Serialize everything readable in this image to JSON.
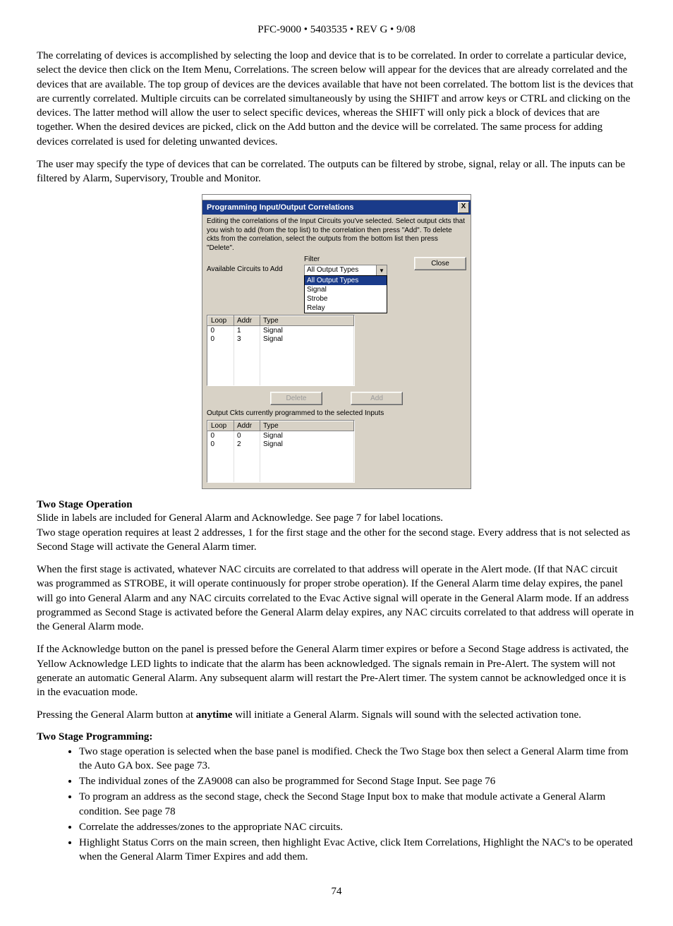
{
  "header": "PFC-9000 • 5403535 • REV G • 9/08",
  "para1": "The correlating of devices is accomplished by selecting the loop and device that is to be correlated. In order to correlate a particular device, select the device then click on the Item Menu, Correlations. The screen below will appear for the devices that are already correlated and the devices that are available. The top group of devices are the devices available that have not been correlated. The bottom list is the devices that are currently correlated. Multiple circuits can be correlated simultaneously by using the SHIFT and arrow keys or CTRL and clicking on the devices. The latter method will allow the user to select specific devices, whereas the SHIFT will only pick a block of devices that are together. When the desired devices are picked, click on the Add button and the device will be correlated. The same process for adding devices correlated is used for deleting unwanted devices.",
  "para2": "The user may specify the type of devices that can be correlated. The outputs can be filtered by strobe, signal, relay or all. The inputs can be filtered by Alarm, Supervisory, Trouble and Monitor.",
  "dialog": {
    "title": "Programming Input/Output Correlations",
    "close_x": "X",
    "intro": "Editing the correlations of the Input Circuits you've selected. Select output ckts that you wish to add (from the top list) to the correlation then press \"Add\". To delete ckts from the correlation, select the outputs from the bottom list then press \"Delete\".",
    "filter_label": "Filter",
    "filter_value": "All Output Types",
    "filter_options": [
      "All Output Types",
      "Signal",
      "Strobe",
      "Relay"
    ],
    "close_label": "Close",
    "available_label": "Available Circuits to Add",
    "cols": [
      "Loop",
      "Addr",
      "Type"
    ],
    "available_rows": [
      {
        "loop": "0",
        "addr": "1",
        "type": "Signal"
      },
      {
        "loop": "0",
        "addr": "3",
        "type": "Signal"
      }
    ],
    "delete_label": "Delete",
    "add_label": "Add",
    "programmed_label": "Output Ckts currently programmed to the selected Inputs",
    "programmed_rows": [
      {
        "loop": "0",
        "addr": "0",
        "type": "Signal"
      },
      {
        "loop": "0",
        "addr": "2",
        "type": "Signal"
      }
    ]
  },
  "section1_heading": "Two Stage Operation",
  "section1_p1": "Slide in labels are included for General Alarm and Acknowledge. See page 7 for label locations.",
  "section1_p2": "Two stage operation requires at least 2 addresses, 1 for the first stage and the other for the second stage. Every address that is not selected as Second Stage will activate the General Alarm timer.",
  "section1_p3": "When the first stage is activated, whatever NAC circuits are correlated to that address will operate in the Alert mode. (If that NAC circuit was programmed as STROBE, it will operate continuously for proper strobe operation). If the General Alarm time delay expires, the panel will go into General Alarm and any NAC circuits correlated to the Evac Active signal will operate in the General Alarm mode. If an address programmed as Second Stage is activated before the General Alarm delay expires, any NAC circuits correlated to that address will operate in the General Alarm mode.",
  "section1_p4": "If the Acknowledge button on the panel is pressed before the General Alarm timer expires or before a Second Stage address is activated, the Yellow Acknowledge LED lights to indicate that the alarm has been acknowledged. The signals remain in Pre-Alert. The system will not generate an automatic General Alarm. Any subsequent alarm will restart the Pre-Alert timer. The system cannot be acknowledged once it is in the evacuation mode.",
  "section1_p5a": "Pressing the General Alarm button at ",
  "section1_p5_bold": "anytime",
  "section1_p5b": " will initiate a General Alarm. Signals will sound with the selected activation tone.",
  "section2_heading": "Two Stage Programming:",
  "bullets": [
    "Two stage operation is selected when the base panel is modified. Check the Two Stage box then select a General Alarm time from the Auto GA box. See page 73.",
    "The individual zones of the ZA9008 can also be programmed for Second Stage Input. See page 76",
    "To program an address as the second stage, check the Second Stage Input box to make that module activate  a General Alarm condition. See page 78",
    "Correlate the addresses/zones to the appropriate NAC circuits.",
    "Highlight Status Corrs on the main screen, then highlight Evac Active, click Item Correlations, Highlight the NAC's to be operated when the General Alarm Timer Expires and add them."
  ],
  "page_number": "74"
}
